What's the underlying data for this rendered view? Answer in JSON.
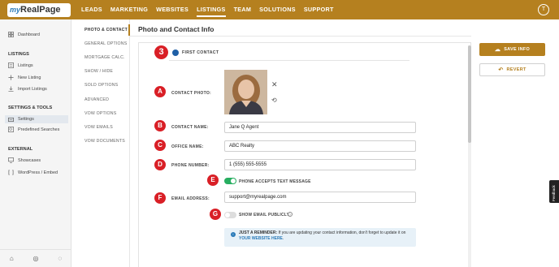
{
  "app": {
    "logo_prefix": "my",
    "logo_name": "RealPage",
    "user_initial": "T"
  },
  "nav": {
    "items": [
      "LEADS",
      "MARKETING",
      "WEBSITES",
      "LISTINGS",
      "TEAM",
      "SOLUTIONS",
      "SUPPORT"
    ],
    "active": "LISTINGS"
  },
  "sidebar": {
    "dashboard": "Dashboard",
    "listings_head": "LISTINGS",
    "listings": "Listings",
    "new_listing": "New Listing",
    "import_listings": "Import Listings",
    "settings_head": "SETTINGS & TOOLS",
    "settings": "Settings",
    "predefined_searches": "Predefined Searches",
    "external_head": "EXTERNAL",
    "showcases": "Showcases",
    "wordpress": "WordPress / Embed"
  },
  "subnav": {
    "items": [
      "PHOTO & CONTACT",
      "GENERAL OPTIONS",
      "MORTGAGE CALC.",
      "SHOW / HIDE",
      "SOLD OPTIONS",
      "ADVANCED",
      "VOW OPTIONS",
      "VOW EMAILS",
      "VOW DOCUMENTS"
    ],
    "active": "PHOTO & CONTACT"
  },
  "page": {
    "title": "Photo and Contact Info",
    "section_step": "3",
    "section_label": "FIRST CONTACT"
  },
  "markers": [
    "A",
    "B",
    "C",
    "D",
    "E",
    "F",
    "G"
  ],
  "form": {
    "contact_photo_label": "CONTACT PHOTO:",
    "contact_name_label": "CONTACT NAME:",
    "contact_name_value": "Jane Q Agent",
    "office_name_label": "OFFICE NAME:",
    "office_name_value": "ABC Realty",
    "phone_label": "PHONE NUMBER:",
    "phone_value": "1 (555) 555-5555",
    "text_toggle_label": "PHONE ACCEPTS TEXT MESSAGE",
    "text_toggle_on": true,
    "email_label": "EMAIL ADDRESS:",
    "email_value": "support@myrealpage.com",
    "show_email_label": "SHOW EMAIL PUBLICLY",
    "show_email_on": false,
    "help_glyph": "?"
  },
  "reminder": {
    "icon_glyph": "i",
    "lead": "JUST A REMINDER:",
    "body": "If you are updating your contact information, don't forget to update it on",
    "link": "YOUR WEBSITE HERE",
    "end": "."
  },
  "actions": {
    "save": "SAVE INFO",
    "revert": "REVERT"
  },
  "feedback": "Feedback",
  "colors": {
    "brand": "#b5801f",
    "marker_red": "#d91f26",
    "toggle_on": "#27ae60",
    "link_blue": "#2a7ab8"
  }
}
